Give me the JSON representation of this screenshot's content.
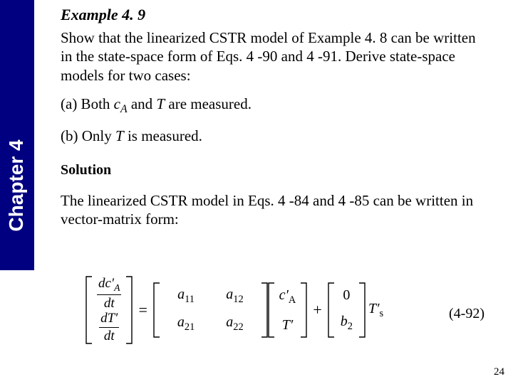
{
  "sidebar": {
    "label": "Chapter 4"
  },
  "title": "Example 4. 9",
  "para1_a": "Show that the linearized CSTR model of Example 4. 8 can be written in the state-space form of Eqs. 4 -90 and 4 -91. Derive state-space models for two cases:",
  "item_a_prefix": "(a)  Both ",
  "item_a_var1": "c",
  "item_a_sub": "A",
  "item_a_mid": " and ",
  "item_a_var2": "T",
  "item_a_suffix": " are measured.",
  "item_b_prefix": "(b)  Only ",
  "item_b_var": "T",
  "item_b_suffix": " is measured.",
  "solution": "Solution",
  "para2": "The linearized CSTR model in Eqs. 4 -84 and 4 -85 can be written in vector-matrix form:",
  "eq": {
    "lhs_top_num": "dc′",
    "lhs_top_numsub": "A",
    "lhs_top_den": "dt",
    "lhs_bot_num": "dT′",
    "lhs_bot_den": "dt",
    "a11": "a",
    "a11s": "11",
    "a12": "a",
    "a12s": "12",
    "a21": "a",
    "a21s": "21",
    "a22": "a",
    "a22s": "22",
    "x1": "c′",
    "x1s": "A",
    "x2": "T′",
    "b1": "0",
    "b2": "b",
    "b2s": "2",
    "u": "T′",
    "us": "s",
    "num": "(4-92)"
  },
  "page": "24"
}
